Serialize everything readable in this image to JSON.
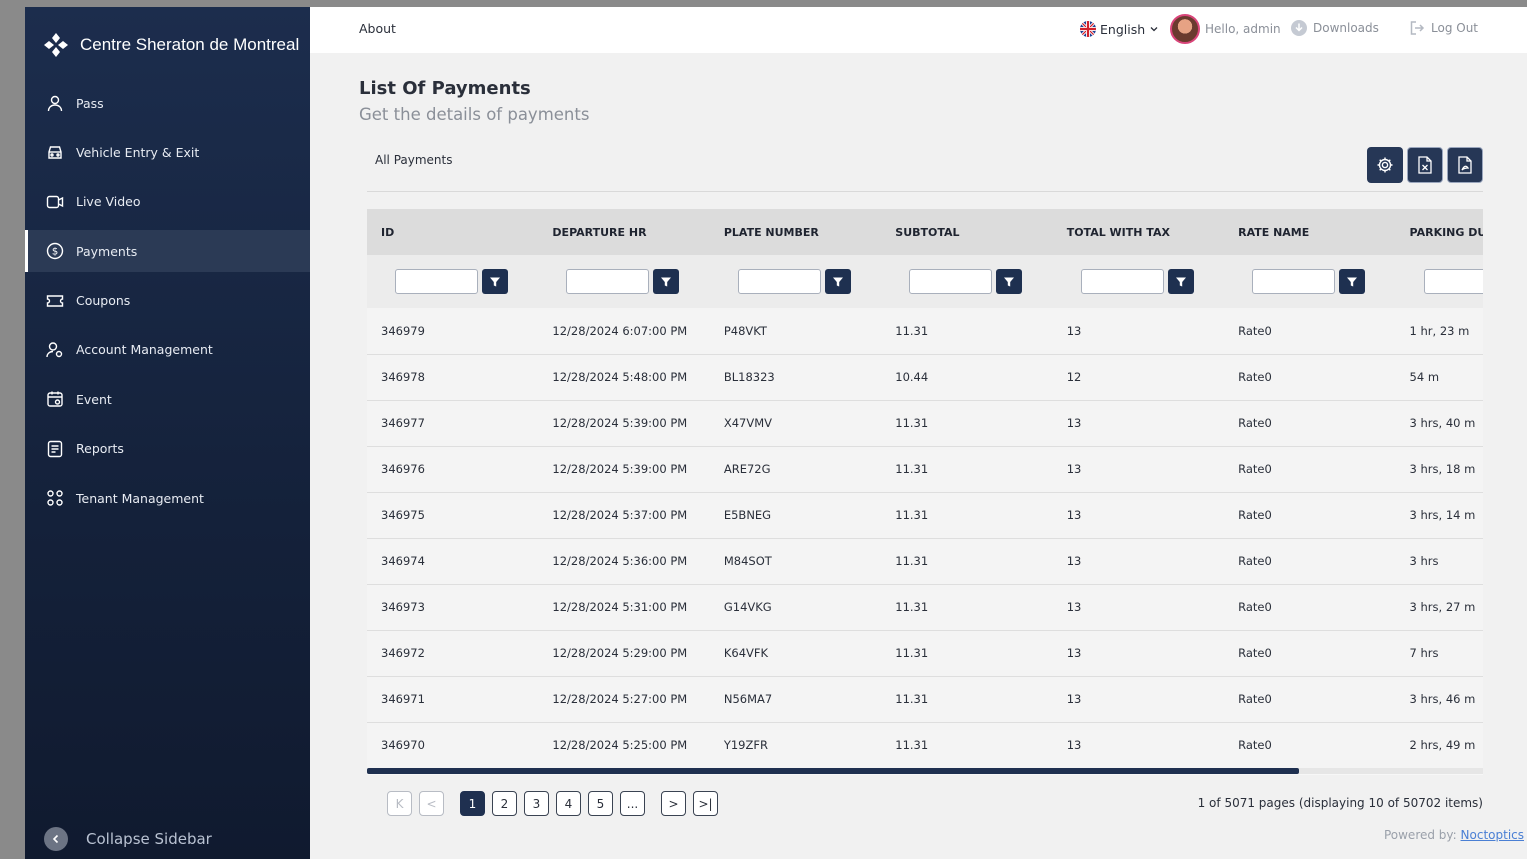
{
  "brand": {
    "name": "Centre Sheraton de Montreal"
  },
  "sidebar": {
    "items": [
      {
        "label": "Pass",
        "icon": "user-icon"
      },
      {
        "label": "Vehicle Entry & Exit",
        "icon": "car-icon"
      },
      {
        "label": "Live Video",
        "icon": "video-icon"
      },
      {
        "label": "Payments",
        "icon": "dollar-icon",
        "active": true
      },
      {
        "label": "Coupons",
        "icon": "ticket-icon"
      },
      {
        "label": "Account Management",
        "icon": "user-settings-icon"
      },
      {
        "label": "Event",
        "icon": "calendar-icon"
      },
      {
        "label": "Reports",
        "icon": "report-icon"
      },
      {
        "label": "Tenant Management",
        "icon": "group-icon"
      }
    ],
    "collapse_label": "Collapse Sidebar"
  },
  "topbar": {
    "about": "About",
    "language": "English",
    "greeting": "Hello, admin",
    "downloads": "Downloads",
    "logout": "Log Out"
  },
  "page": {
    "title": "List Of Payments",
    "subtitle": "Get the details of payments",
    "section": "All Payments"
  },
  "table": {
    "columns": [
      "ID",
      "DEPARTURE HR",
      "PLATE NUMBER",
      "SUBTOTAL",
      "TOTAL WITH TAX",
      "RATE NAME",
      "PARKING DURATIO"
    ],
    "rows": [
      [
        "346979",
        "12/28/2024 6:07:00 PM",
        "P48VKT",
        "11.31",
        "13",
        "Rate0",
        "1 hr, 23 m"
      ],
      [
        "346978",
        "12/28/2024 5:48:00 PM",
        "BL18323",
        "10.44",
        "12",
        "Rate0",
        "54 m"
      ],
      [
        "346977",
        "12/28/2024 5:39:00 PM",
        "X47VMV",
        "11.31",
        "13",
        "Rate0",
        "3 hrs, 40 m"
      ],
      [
        "346976",
        "12/28/2024 5:39:00 PM",
        "ARE72G",
        "11.31",
        "13",
        "Rate0",
        "3 hrs, 18 m"
      ],
      [
        "346975",
        "12/28/2024 5:37:00 PM",
        "E5BNEG",
        "11.31",
        "13",
        "Rate0",
        "3 hrs, 14 m"
      ],
      [
        "346974",
        "12/28/2024 5:36:00 PM",
        "M84SOT",
        "11.31",
        "13",
        "Rate0",
        "3 hrs"
      ],
      [
        "346973",
        "12/28/2024 5:31:00 PM",
        "G14VKG",
        "11.31",
        "13",
        "Rate0",
        "3 hrs, 27 m"
      ],
      [
        "346972",
        "12/28/2024 5:29:00 PM",
        "K64VFK",
        "11.31",
        "13",
        "Rate0",
        "7 hrs"
      ],
      [
        "346971",
        "12/28/2024 5:27:00 PM",
        "N56MA7",
        "11.31",
        "13",
        "Rate0",
        "3 hrs, 46 m"
      ],
      [
        "346970",
        "12/28/2024 5:25:00 PM",
        "Y19ZFR",
        "11.31",
        "13",
        "Rate0",
        "2 hrs, 49 m"
      ]
    ]
  },
  "pagination": {
    "first": "K",
    "prev": "<",
    "pages": [
      "1",
      "2",
      "3",
      "4",
      "5",
      "..."
    ],
    "next": ">",
    "last": ">|",
    "info": "1 of 5071 pages (displaying 10 of 50702 items)"
  },
  "footer": {
    "powered_by": "Powered by:",
    "company": "Noctoptics"
  },
  "colors": {
    "sidebar": "#1c2d4d",
    "accent": "#1f3050",
    "background": "#f1f1f1"
  }
}
